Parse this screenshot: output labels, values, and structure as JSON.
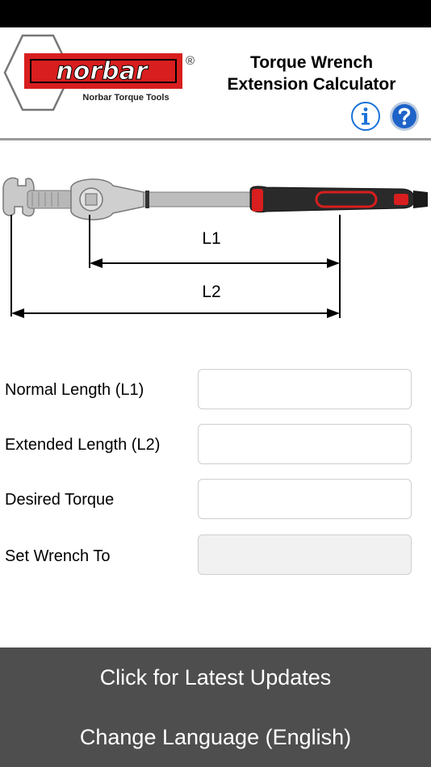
{
  "header": {
    "brand_name": "norbar",
    "brand_registered": "®",
    "brand_tagline": "Norbar Torque Tools",
    "title_line1": "Torque Wrench",
    "title_line2": "Extension Calculator",
    "info_icon": "info-circle-icon",
    "help_icon": "question-circle-icon"
  },
  "diagram": {
    "l1_label": "L1",
    "l2_label": "L2"
  },
  "form": {
    "normal_length_label": "Normal Length (L1)",
    "normal_length_value": "",
    "extended_length_label": "Extended Length (L2)",
    "extended_length_value": "",
    "desired_torque_label": "Desired Torque",
    "desired_torque_value": "",
    "set_wrench_label": "Set Wrench To",
    "set_wrench_value": ""
  },
  "bottom": {
    "updates_label": "Click for Latest Updates",
    "language_label": "Change Language (English)"
  },
  "colors": {
    "brand_red": "#d81e1e",
    "info_blue": "#1a73d9",
    "bottom_bar": "#4e4e4e",
    "divider": "#9a9a9a"
  }
}
